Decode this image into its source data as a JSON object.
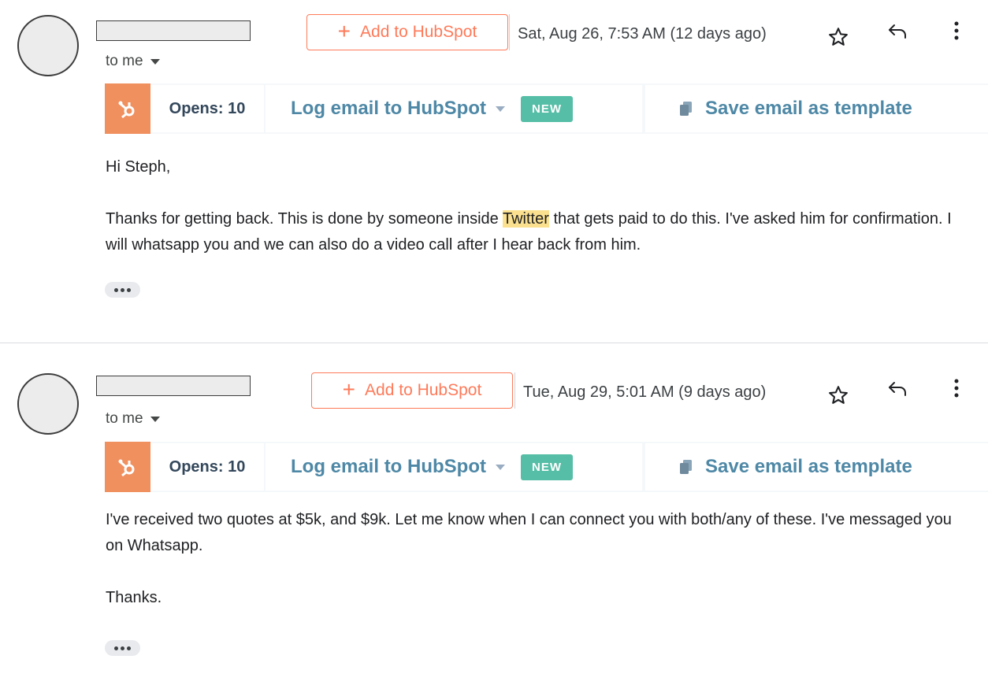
{
  "messages": [
    {
      "to_me": "to me",
      "add_to_hubspot": "Add to HubSpot",
      "date": "Sat, Aug 26, 7:53 AM (12 days ago)",
      "opens": "Opens: 10",
      "log_email": "Log email to HubSpot",
      "new_badge": "NEW",
      "save_template": "Save email as template",
      "greeting": "Hi Steph,",
      "para_before": "Thanks for getting back. This is done by someone inside ",
      "highlight": "Twitter",
      "para_after": " that gets paid to do this. I've asked him for confirmation. I will whatsapp you and we can also do a video call after I hear back from him."
    },
    {
      "to_me": "to me",
      "add_to_hubspot": "Add to HubSpot",
      "date": "Tue, Aug 29, 5:01 AM (9 days ago)",
      "opens": "Opens: 10",
      "log_email": "Log email to HubSpot",
      "new_badge": "NEW",
      "save_template": "Save email as template",
      "paragraph": "I've received two quotes at $5k, and $9k. Let me know when I can connect you with both/any of these. I've messaged you on Whatsapp.",
      "closing": "Thanks."
    }
  ],
  "icons": {
    "star": "star-icon",
    "reply": "reply-icon",
    "more": "more-vert-icon",
    "hubspot": "hubspot-logo-icon",
    "copy": "copy-icon",
    "plus": "plus-icon"
  },
  "colors": {
    "hubspot_orange": "#ff7a59",
    "hubspot_logo_bg": "#f0905f",
    "link_blue": "#4e88a6",
    "new_badge": "#56bea6",
    "highlight": "#fbe18f"
  }
}
